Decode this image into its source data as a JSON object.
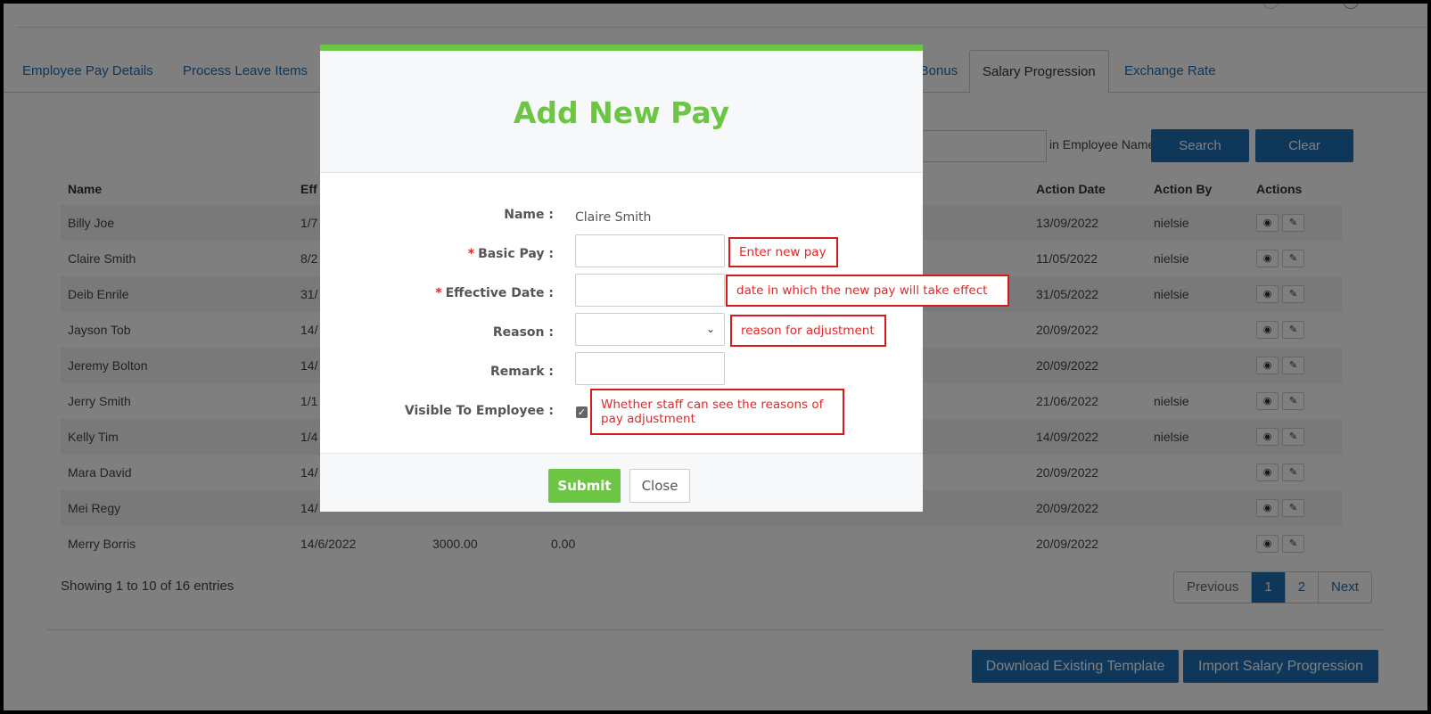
{
  "tabs": [
    {
      "label": "Employee Pay Details",
      "active": false
    },
    {
      "label": "Process Leave Items",
      "active": false
    },
    {
      "label": "s Bonus",
      "active": false
    },
    {
      "label": "Salary Progression",
      "active": true
    },
    {
      "label": "Exchange Rate",
      "active": false
    }
  ],
  "search": {
    "hint": "in Employee Name",
    "search_label": "Search",
    "clear_label": "Clear"
  },
  "table": {
    "columns": [
      "Name",
      "Eff",
      "",
      "",
      "Action Date",
      "Action By",
      "Actions"
    ],
    "rows": [
      {
        "name": "Billy Joe",
        "eff": "1/7",
        "c3": "",
        "c4": "",
        "date": "13/09/2022",
        "by": "nielsie"
      },
      {
        "name": "Claire Smith",
        "eff": "8/2",
        "c3": "",
        "c4": "",
        "date": "11/05/2022",
        "by": "nielsie"
      },
      {
        "name": "Deib Enrile",
        "eff": "31/",
        "c3": "",
        "c4": "",
        "date": "31/05/2022",
        "by": "nielsie"
      },
      {
        "name": "Jayson Tob",
        "eff": "14/",
        "c3": "",
        "c4": "",
        "date": "20/09/2022",
        "by": ""
      },
      {
        "name": "Jeremy Bolton",
        "eff": "14/",
        "c3": "",
        "c4": "",
        "date": "20/09/2022",
        "by": ""
      },
      {
        "name": "Jerry Smith",
        "eff": "1/1",
        "c3": "",
        "c4": "",
        "date": "21/06/2022",
        "by": "nielsie"
      },
      {
        "name": "Kelly Tim",
        "eff": "1/4",
        "c3": "",
        "c4": "",
        "date": "14/09/2022",
        "by": "nielsie"
      },
      {
        "name": "Mara David",
        "eff": "14/",
        "c3": "",
        "c4": "",
        "date": "20/09/2022",
        "by": ""
      },
      {
        "name": "Mei Regy",
        "eff": "14/",
        "c3": "",
        "c4": "",
        "date": "20/09/2022",
        "by": ""
      },
      {
        "name": "Merry Borris",
        "eff": "14/6/2022",
        "c3": "3000.00",
        "c4": "0.00",
        "date": "20/09/2022",
        "by": ""
      }
    ]
  },
  "footer": {
    "showing": "Showing 1 to 10 of 16 entries"
  },
  "pager": {
    "previous": "Previous",
    "page1": "1",
    "page2": "2",
    "next": "Next"
  },
  "bottom_buttons": {
    "download": "Download Existing Template",
    "import": "Import Salary Progression"
  },
  "modal": {
    "title": "Add New Pay",
    "name_label": "Name :",
    "name_value": "Claire Smith",
    "basic_pay_label": "Basic Pay :",
    "effective_date_label": "Effective Date :",
    "reason_label": "Reason :",
    "remark_label": "Remark :",
    "visible_label": "Visible To Employee :",
    "required_mark": "*",
    "submit_label": "Submit",
    "close_label": "Close"
  },
  "annotations": {
    "basic_pay": "Enter new pay",
    "effective_date": "date in which the new pay will take effect",
    "reason": "reason for adjustment",
    "visible": "Whether staff can see the reasons of pay adjustment"
  },
  "colors": {
    "accent_green": "#6cc644",
    "primary_blue": "#1f6fb5",
    "annotation_red": "#e0282a"
  }
}
